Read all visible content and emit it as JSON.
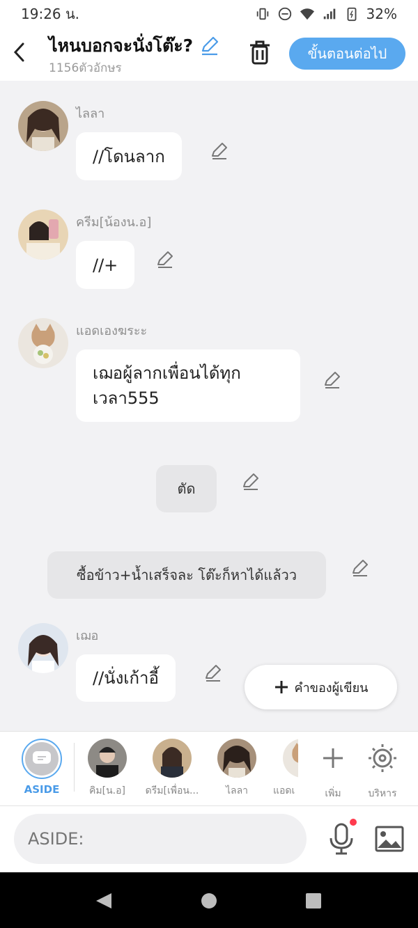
{
  "status": {
    "time": "19:26 น.",
    "battery": "32%"
  },
  "header": {
    "title": "ไหนบอกจะนั่งโต๊ะ?",
    "char_count": "1156ตัวอักษร",
    "next_label": "ขั้นตอนต่อไป"
  },
  "messages": [
    {
      "name": "ไลลา",
      "text": "//โดนลาก"
    },
    {
      "name": "ครีม[น้องน.อ]",
      "text": "//+"
    },
    {
      "name": "แอดเองฆระะ",
      "text": "เฌอผู้ลากเพื่อนได้ทุกเวลา555"
    },
    {
      "name": "",
      "text": "ตัด"
    },
    {
      "name": "",
      "text": "ซื้อข้าว+น้ำเสร็จละ โต๊ะก็หาได้แล้วว"
    },
    {
      "name": "เฌอ",
      "text": "//นั่งเก้าอี้"
    }
  ],
  "author_button": "คำของผู้เขียน",
  "charbar": {
    "aside_label": "ASIDE",
    "characters": [
      "คิม[น.อ]",
      "ดรีม[เพื่อน...",
      "ไลลา",
      "แอดเ"
    ],
    "add_label": "เพิ่ม",
    "manage_label": "บริหาร"
  },
  "input": {
    "placeholder": "ASIDE:"
  },
  "colors": {
    "accent": "#5aa9ef",
    "background": "#f2f2f4",
    "bubble": "#ffffff",
    "narration": "#e6e6e8"
  },
  "icons": [
    "back-arrow-icon",
    "pencil-icon",
    "trash-icon",
    "plus-icon",
    "gear-icon",
    "microphone-icon",
    "image-icon",
    "chat-bubble-icon"
  ]
}
